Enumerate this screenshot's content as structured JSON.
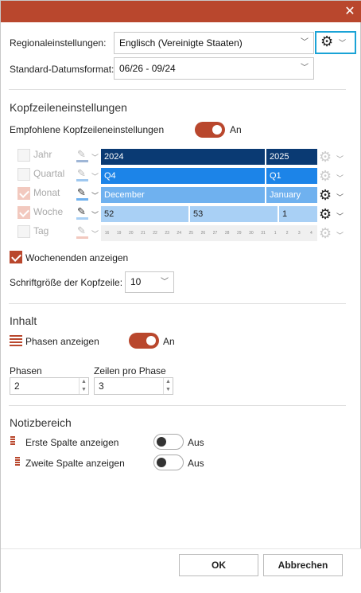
{
  "colors": {
    "accent": "#b9472d",
    "dark_blue": "#0a3a73",
    "mid_blue": "#1c84e8",
    "light_blue": "#6fb1ef",
    "pale_blue": "#a9d0f5",
    "focus": "#1aa3d6"
  },
  "regional": {
    "label": "Regionaleinstellungen:",
    "value": "Englisch (Vereinigte Staaten)",
    "settings_icon": "gear-icon"
  },
  "dateformat": {
    "label": "Standard-Datumsformat:",
    "value": "06/26 - 09/24"
  },
  "header_settings": {
    "title": "Kopfzeileneinstellungen",
    "recommended_label": "Empfohlene Kopfzeileneinstellungen",
    "recommended_state": "An"
  },
  "rows": [
    {
      "label": "Jahr",
      "cells": [
        "2024",
        "2025"
      ],
      "checked": false,
      "enabled": false
    },
    {
      "label": "Quartal",
      "cells": [
        "Q4",
        "Q1"
      ],
      "checked": false,
      "enabled": false
    },
    {
      "label": "Monat",
      "cells": [
        "December",
        "January"
      ],
      "checked": true,
      "enabled": false
    },
    {
      "label": "Woche",
      "cells": [
        "52",
        "53",
        "1"
      ],
      "checked": true,
      "enabled": false
    },
    {
      "label": "Tag",
      "days": [
        "16",
        "19",
        "20",
        "21",
        "22",
        "23",
        "24",
        "25",
        "26",
        "27",
        "28",
        "29",
        "30",
        "31",
        "1",
        "2",
        "3",
        "4"
      ],
      "checked": false,
      "enabled": false
    }
  ],
  "weekends": {
    "label": "Wochenenden anzeigen",
    "checked": true
  },
  "fontsize": {
    "label": "Schriftgröße der Kopfzeile:",
    "value": "10"
  },
  "content": {
    "title": "Inhalt",
    "phases_label": "Phasen anzeigen",
    "phases_state": "An",
    "phases_count_label": "Phasen",
    "phases_count": "2",
    "rows_per_phase_label": "Zeilen pro Phase",
    "rows_per_phase": "3"
  },
  "notes": {
    "title": "Notizbereich",
    "col1_label": "Erste Spalte anzeigen",
    "col1_state": "Aus",
    "col2_label": "Zweite Spalte anzeigen",
    "col2_state": "Aus"
  },
  "buttons": {
    "ok": "OK",
    "cancel": "Abbrechen"
  }
}
